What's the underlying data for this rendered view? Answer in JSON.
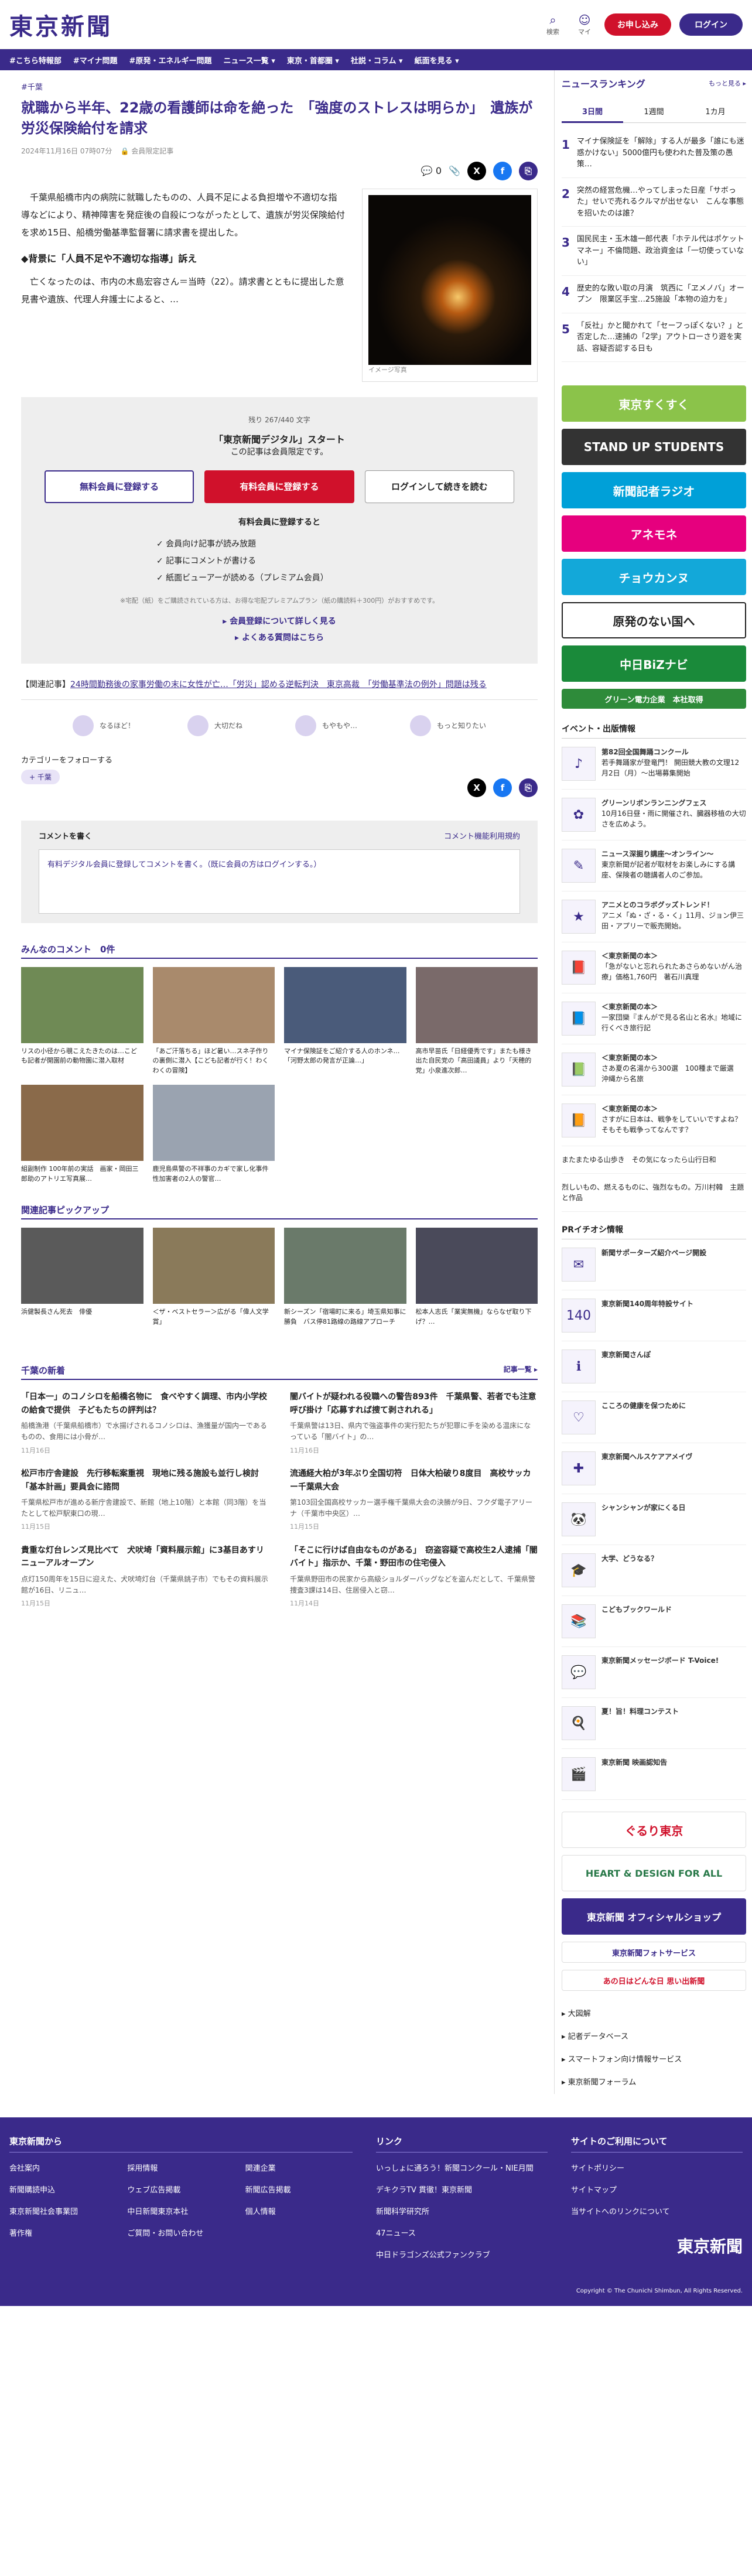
{
  "header": {
    "logo": "東京新聞",
    "search": "検索",
    "my": "マイ",
    "signup": "お申し込み",
    "login": "ログイン"
  },
  "nav": [
    "#こちら特報部",
    "#マイナ問題",
    "#原発・エネルギー問題",
    "ニュース一覧 ▾",
    "東京・首都圏 ▾",
    "社説・コラム ▾",
    "紙面を見る ▾"
  ],
  "article": {
    "crumb": "#千葉",
    "title": "就職から半年、22歳の看護師は命を絶った　「強度のストレスは明らか」　遺族が労災保険給付を請求",
    "date": "2024年11月16日 07時07分",
    "badge": "会員限定記事",
    "comments": "0",
    "p1": "　千葉県船橋市内の病院に就職したものの、人員不足による負担増や不適切な指導などにより、精神障害を発症後の自殺につながったとして、遺族が労災保険給付を求め15日、船橋労働基準監督署に請求書を提出した。",
    "h": "◆背景に「人員不足や不適切な指導」訴え",
    "p2": "　亡くなったのは、市内の木島宏容さん＝当時（22）。請求書とともに提出した意見書や遺族、代理人弁護士によると、…",
    "photo_caption": "イメージ写真"
  },
  "paywall": {
    "count": "残り 267/440 文字",
    "title": "「東京新聞デジタル」スタート",
    "sub": "この記事は会員限定です。",
    "free": "無料会員に登録する",
    "paid": "有料会員に登録する",
    "login": "ログインして続きを読む",
    "perk_title": "有料会員に登録すると",
    "perks": [
      "✓ 会員向け記事が読み放題",
      "✓ 記事にコメントが書ける",
      "✓ 紙面ビューアーが読める（プレミアム会員）"
    ],
    "note": "※宅配（紙）をご購読されている方は、お得な宅配プレミアムプラン（紙の購読料＋300円）がおすすめです。",
    "more": "▸ 会員登録について詳しく見る",
    "faq": "▸ よくある質問はこちら"
  },
  "related": {
    "label": "【関連記事】",
    "text": "24時間勤務後の家事労働の末に女性が亡…「労災」認める逆転判決　東京高裁　「労働基準法の例外」問題は残る"
  },
  "reactions": [
    "なるほど！",
    "大切だね",
    "もやもや…",
    "もっと知りたい"
  ],
  "follow": {
    "label": "カテゴリーをフォローする",
    "tag": "千葉"
  },
  "comment": {
    "title": "コメントを書く",
    "rule": "コメント機能利用規約",
    "prompt": "有料デジタル会員に登録してコメントを書く。（既に会員の方はログインする。）"
  },
  "everyone": {
    "title": "みんなのコメント　0件",
    "cards": [
      "リスの小径から覗こえたきたのは…こども記者が開園前の動物園に潜入取材",
      "「あご汗落ちる」ほど暑い…スネ子作りの裏側に潜入【こども記者が行く！わくわくの冒険】",
      "マイナ保険証をご紹介する人のホンネ…「河野太郎の発言が正論…」",
      "高市早苗氏「日経優秀です」またも様き出た自民党の「高田議員」より「天穂的党」小泉進次郎…",
      "組副制作 100年前の実話　画家・岡田三郎助のアトリエ写真展…",
      "鹿児島県警の不祥事のカギで家し化事件　性加害者の2人の警官…"
    ]
  },
  "pickup": {
    "title": "関連記事ピックアップ",
    "cards": [
      "浜健製長さん死去　俳優",
      "＜ザ・ベストセラー＞広がる「偉人文学賞」",
      "新シーズン「宿場町に来る」埼玉県知事に勝負　バス停81路線の路線アプローチ",
      "松本人志氏「業実無機」ならなぜ取り下げ？…"
    ]
  },
  "chiba": {
    "title": "千葉の新着",
    "more": "記事一覧 ▸",
    "items": [
      {
        "t": "「日本一」のコノシロを船橋名物に　食べやすく調理、市内小学校の給食で提供　子どもたちの評判は？",
        "d": "船橋漁港（千葉県船橋市）で水揚げされるコノシロは、漁獲量が国内一であるものの、食用には小骨が…",
        "dt": "11月16日"
      },
      {
        "t": "闇バイトが疑われる役職への警告893件　千葉県警、若者でも注意呼び掛け「応募すれば捜て剥されれる」",
        "d": "千葉県警は13日、県内で強盗事件の実行犯たちが犯罪に手を染める温床になっている「闇バイト」の…",
        "dt": "11月16日"
      },
      {
        "t": "松戸市庁舎建設　先行移転案重視　現地に残る施設も並行し検討「基本計画」要員会に諮問",
        "d": "千葉県松戸市が進める新庁舎建設で、新館（地上10階）と本館（同3階）を当たとして松戸駅東口の現…",
        "dt": "11月15日"
      },
      {
        "t": "流通経大柏が3年ぶり全国切符　日体大柏破り8度目　高校サッカー千葉県大会",
        "d": "第103回全国高校サッカー選手権千葉県大会の決勝が9日、フクダ電子アリーナ（千葉市中央区）…",
        "dt": "11月15日"
      },
      {
        "t": "貴重な灯台レンズ見比べて　犬吠埼「資料展示館」に3基目あすリニューアルオープン",
        "d": "点灯150周年を15日に迎えた、犬吠埼灯台（千葉県銚子市）でもその資料展示館が16日、リニュ…",
        "dt": "11月15日"
      },
      {
        "t": "「そこに行けば自由なものがある」　窃盗容疑で高校生2人逮捕「闇バイト」指示か、千葉・野田市の住宅侵入",
        "d": "千葉県野田市の民家から高級ショルダーバッグなどを盗んだとして、千葉県警捜査3課は14日、住居侵入と窃…",
        "dt": "11月14日"
      }
    ]
  },
  "ranking": {
    "title": "ニュースランキング",
    "more": "もっと見る ▸",
    "tabs": [
      "3日間",
      "1週間",
      "1カ月"
    ],
    "items": [
      "マイナ保険証を「解除」する人が最多「誰にも迷惑かけない」5000億円も使われた普及策の愚策…",
      "突然の経営危機…やってしまった日産「サボった」せいで売れるクルマが出せない　こんな事態を招いたのは誰？",
      "国民民主・玉木雄一郎代表「ホテル代はポケットマネー」不倫問題、政治資金は「一切使っていない」",
      "歴史的な敗い取の月演　筑西に「ヱメノバ」オープン　限業区手宝…25施設「本物の迫力を」",
      "「反社」かと聞かれて「セーフっぽくない？」と否定した…速捕の「2学」アウトローさり遊を実話、容疑否認する日も"
    ]
  },
  "banners": [
    "東京すくすく",
    "STAND UP STUDENTS",
    "新聞記者ラジオ",
    "アネモネ",
    "チョウカンヌ",
    "原発のない国へ",
    "中日BiZナビ",
    "グリーン電力企業　本社取得"
  ],
  "events": {
    "title": "イベント・出版情報",
    "items": [
      {
        "b": "第82回全国舞踊コンクール",
        "s": "若手舞踊家が登竜門！ 開田競大教の文理12月2日（月）〜出場募集開始"
      },
      {
        "b": "グリーンリボンランニングフェス",
        "s": "10月16日昼・雨に開催され、臓器移植の大切さを広めよう。"
      },
      {
        "b": "ニュース深掘り講座〜オンライン〜",
        "s": "東京新聞が記者が取材をお楽しみにする講座、保険者の聴講者人のご参加。"
      },
      {
        "b": "アニメとのコラボグッズトレンド！",
        "s": "アニメ「ぬ・ざ・る・く」11月、ジョン伊三田・アプリーで販売開始。"
      },
      {
        "b": "＜東京新聞の本＞",
        "s": "「急がないと忘れられたあさらめないがん治療」価格1,760円　著石川真理"
      },
      {
        "b": "＜東京新聞の本＞",
        "s": "一家団欒『まんがで見る名山と名水』地域に行くべき旅行記"
      },
      {
        "b": "＜東京新聞の本＞",
        "s": "さあ夏の名湯から300選　100種まで厳選　沖縄から名旅"
      },
      {
        "b": "＜東京新聞の本＞",
        "s": "さすがに日本は、戦争をしていいですよね？　そもそも戦争ってなんです？"
      }
    ]
  },
  "side_extra": [
    "またまたゆる山歩き　その気になったら山行日和",
    "烈しいもの、燃えるものに、強烈なもの。万川村韓　主題と作品"
  ],
  "pr": {
    "title": "PRイチオシ情報",
    "items": [
      "新聞サポーターズ紹介ページ開設",
      "東京新聞140周年特設サイト",
      "東京新聞さんぽ",
      "こころの健康を保つために",
      "東京新聞ヘルスケアアメイヴ",
      "シャンシャンが家にくる日",
      "大学、どうなる？",
      "こどもブックワールド",
      "東京新聞メッセージボード T-Voice!",
      "夏！旨！料理コンテスト",
      "東京新聞 映画認知告"
    ]
  },
  "side_bottom": [
    "ぐるり東京",
    "HEART & DESIGN FOR ALL",
    "東京新聞 オフィシャルショップ",
    "東京新聞フォトサービス",
    "あの日はどんな日 思い出新聞"
  ],
  "side_links": [
    "▸ 大図解",
    "▸ 記者データベース",
    "▸ スマートフォン向け情報サービス",
    "▸ 東京新聞フォーラム"
  ],
  "footer": {
    "c1": "東京新聞から",
    "c1links": [
      "会社案内",
      "採用情報",
      "関連企業",
      "新聞購読申込",
      "ウェブ広告掲載",
      "新聞広告掲載",
      "東京新聞社会事業団",
      "中日新聞東京本社",
      "個人情報",
      "著作権",
      "ご質問・お問い合わせ",
      ""
    ],
    "c2": "リンク",
    "c2links": [
      "いっしょに通ろう！新聞コンクール・NIE月間",
      "デキクラTV 貫徹！東京新聞",
      "新聞科学研究所",
      "47ニュース",
      "中日ドラゴンズ公式ファンクラブ"
    ],
    "c3": "サイトのご利用について",
    "c3links": [
      "サイトポリシー",
      "サイトマップ",
      "当サイトへのリンクについて"
    ],
    "logo": "東京新聞",
    "copy": "Copyright © The Chunichi Shimbun, All Rights Reserved."
  },
  "colors": {
    "brand": "#3a2a8a",
    "accent": "#d0112b"
  }
}
